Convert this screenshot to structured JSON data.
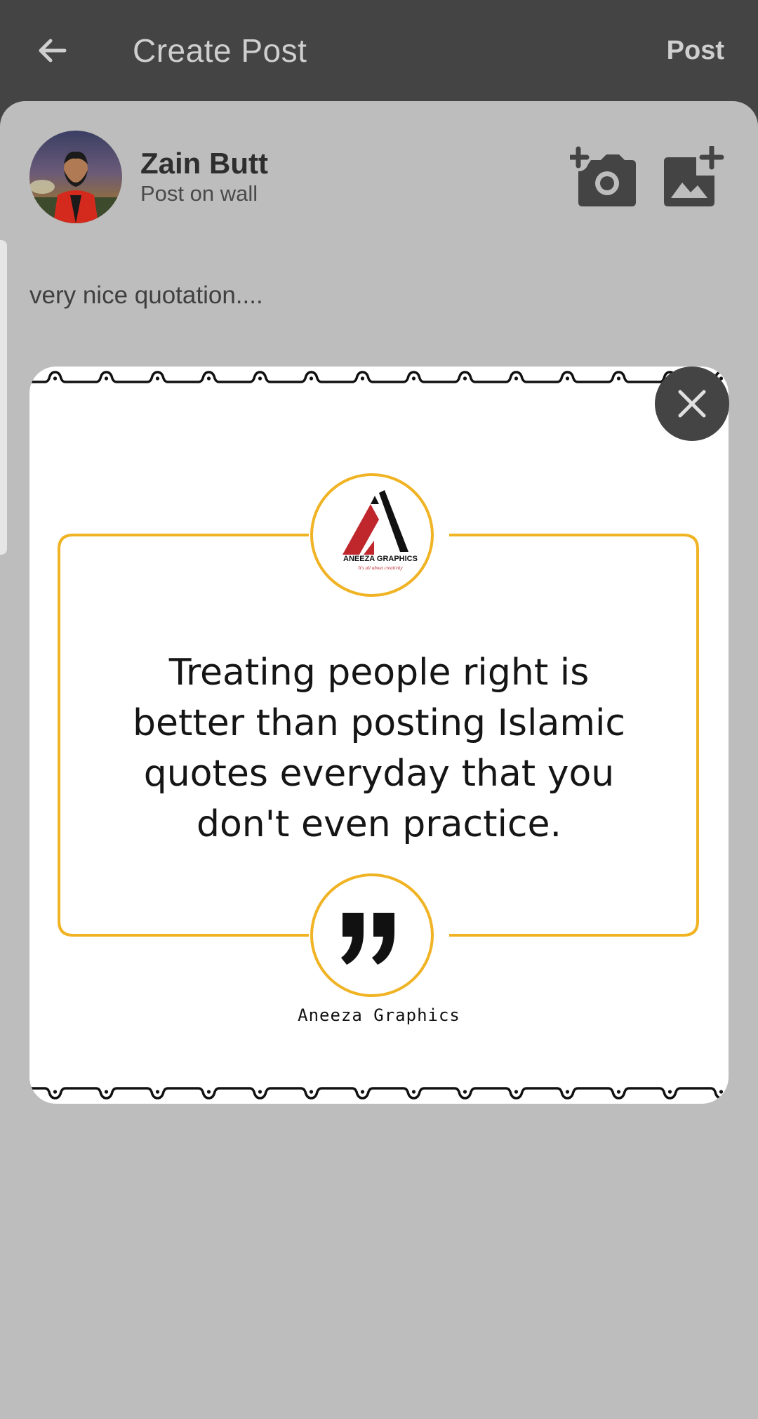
{
  "appbar": {
    "title": "Create Post",
    "post_action": "Post",
    "back_icon": "arrow-back-icon"
  },
  "user": {
    "name": "Zain Butt",
    "subtitle": "Post on wall"
  },
  "toolbar": {
    "camera_icon": "add-camera-icon",
    "gallery_icon": "add-photo-icon"
  },
  "composer": {
    "text": "very nice quotation...."
  },
  "attachment": {
    "quote": "Treating people right is better than posting Islamic quotes everyday that you don't even practice.",
    "brand_caption": "Aneeza Graphics",
    "logo_text": "ANEEZA GRAPHICS",
    "logo_tagline": "It's all about creativity",
    "accent_color": "#f0b323",
    "close_icon": "close-icon"
  },
  "colors": {
    "appbar": "#444444",
    "sheet": "#bdbdbd",
    "text_dark": "#2e2e2e",
    "brand_red": "#c0272d"
  }
}
